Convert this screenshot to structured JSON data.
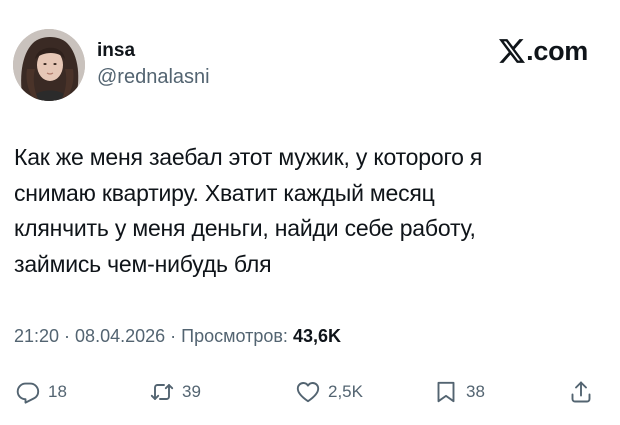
{
  "author": {
    "display_name": "insa",
    "handle": "@rednalasni"
  },
  "brand": {
    "text": ".com",
    "logo_icon": "x-logo-icon"
  },
  "tweet": {
    "text": "Как же меня заебал этот мужик, у которого я\nснимаю квартиру. Хватит каждый месяц\nклянчить у меня деньги, найди себе работу,\nзаймись чем-нибудь бля"
  },
  "meta": {
    "time": "21:20",
    "separator": " · ",
    "date": "08.04.2026",
    "views_label": "Просмотров:",
    "views_count": "43,6K"
  },
  "actions": {
    "reply": {
      "icon": "reply-icon",
      "count": "18"
    },
    "repost": {
      "icon": "repost-icon",
      "count": "39"
    },
    "like": {
      "icon": "heart-icon",
      "count": "2,5K"
    },
    "bookmark": {
      "icon": "bookmark-icon",
      "count": "38"
    },
    "share": {
      "icon": "share-icon"
    }
  },
  "colors": {
    "text_primary": "#0f1419",
    "text_secondary": "#536471",
    "background": "#ffffff"
  }
}
